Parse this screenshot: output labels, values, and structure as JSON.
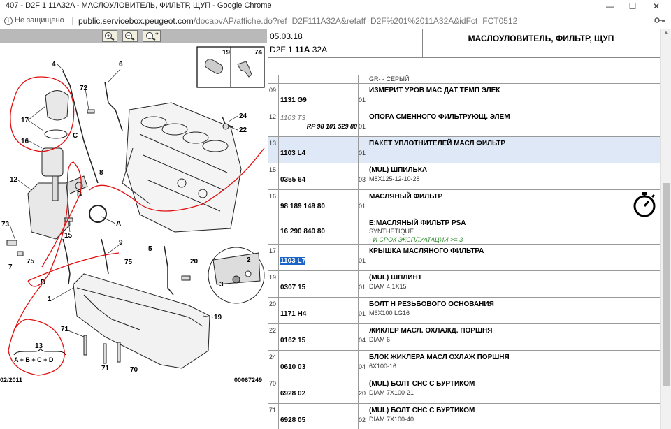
{
  "window": {
    "title": "407 - D2F 1 11A32A - МАСЛОУЛОВИТЕЛЬ, ФИЛЬТР, ЩУП - Google Chrome",
    "controls": [
      "minimize-icon",
      "maximize-icon",
      "close-icon"
    ]
  },
  "address": {
    "security_label": "Не защищено",
    "host": "public.servicebox.peugeot.com",
    "path": "/docapvAP/affiche.do?ref=D2F111A32A&refaff=D2F%201%2011A32A&idFct=FCT0512"
  },
  "diagram": {
    "zoom_buttons": [
      "zoom-in-icon",
      "zoom-out-icon",
      "zoom-fit-icon"
    ],
    "inset_labels": [
      "19",
      "74"
    ],
    "callouts": [
      "4",
      "72",
      "6",
      "17",
      "C",
      "16",
      "12",
      "B",
      "73",
      "15",
      "A",
      "7",
      "75",
      "D",
      "9",
      "5",
      "75",
      "20",
      "2",
      "3",
      "1",
      "19",
      "71",
      "71",
      "70",
      "24",
      "22",
      "8",
      "13"
    ],
    "legend_top": "13",
    "legend_bottom": "A + B + C + D",
    "date": "02/2011",
    "drawing_no": "00067249",
    "accent": "#e01010"
  },
  "header": {
    "date": "05.03.18",
    "code_prefix": "D2F 1",
    "code_bold": "11A",
    "code_suffix": "32A",
    "title": "МАСЛОУЛОВИТЕЛЬ, ФИЛЬТР, ЩУП"
  },
  "rows": [
    {
      "idx": "",
      "ref": "",
      "qty": "",
      "desc": "",
      "line2": "GR- - СЕРЫЙ",
      "h": 12
    },
    {
      "idx": "09",
      "ref": "1131 G9",
      "qty": "01",
      "desc": "ИЗМЕРИТ УРОВ МАС ДАТ ТЕМП ЭЛЕК",
      "h": 38
    },
    {
      "idx": "12",
      "ref": "1103 T3",
      "rp": "RP 98 101 529 80",
      "qty": "01",
      "desc": "ОПОРА СМЕННОГО ФИЛЬТРУЮЩ. ЭЛЕМ",
      "h": 38,
      "ref_italic": true
    },
    {
      "idx": "13",
      "ref": "1103 L4",
      "qty": "01",
      "desc": "ПАКЕТ УПЛОТНИТЕЛЕЙ МАСЛ ФИЛЬТР",
      "h": 38,
      "selected": true
    },
    {
      "idx": "15",
      "ref": "0355 64",
      "qty": "03",
      "desc": "(MUL) ШПИЛЬКА",
      "line2": "M8X125-12-10-28",
      "h": 38
    },
    {
      "idx": "16",
      "ref": "98 189 149 80",
      "ref2": "16 290 840 80",
      "qty": "01",
      "desc": "МАСЛЯНЫЙ ФИЛЬТР",
      "desc2": "E:МАСЛЯНЫЙ ФИЛЬТР PSA",
      "line2": "SYNTHETIQUE",
      "line3": "- И СРОК ЭКСПЛУАТАЦИИ >= 3",
      "h": 78
    },
    {
      "idx": "17",
      "ref": "1103 L7",
      "qty": "01",
      "desc": "КРЫШКА МАСЛЯНОГО ФИЛЬТРА",
      "h": 38,
      "ref_highlight": true
    },
    {
      "idx": "19",
      "ref": "0307 15",
      "qty": "01",
      "desc": "(MUL) ШПЛИНТ",
      "line2": "DIAM 4,1X15",
      "h": 38
    },
    {
      "idx": "20",
      "ref": "1171 H4",
      "qty": "01",
      "desc": "БОЛТ Н РЕЗЬБОВОГО ОСНОВАНИЯ",
      "line2": "M6X100 LG16",
      "h": 38
    },
    {
      "idx": "22",
      "ref": "0162 15",
      "qty": "04",
      "desc": "ЖИКЛЕР МАСЛ. ОХЛАЖД. ПОРШНЯ",
      "line2": "DIAM 6",
      "h": 38
    },
    {
      "idx": "24",
      "ref": "0610 03",
      "qty": "04",
      "desc": "БЛОК ЖИКЛЕРА МАСЛ ОХЛАЖ ПОРШНЯ",
      "line2": "6X100-16",
      "h": 38
    },
    {
      "idx": "70",
      "ref": "6928 02",
      "qty": "20",
      "desc": "(MUL) БОЛТ СНС С БУРТИКОМ",
      "line2": "DIAM 7X100-21",
      "h": 38
    },
    {
      "idx": "71",
      "ref": "6928 05",
      "qty": "02",
      "desc": "(MUL) БОЛТ СНС С БУРТИКОМ",
      "line2": "DIAM 7X100-40",
      "h": 38
    }
  ]
}
